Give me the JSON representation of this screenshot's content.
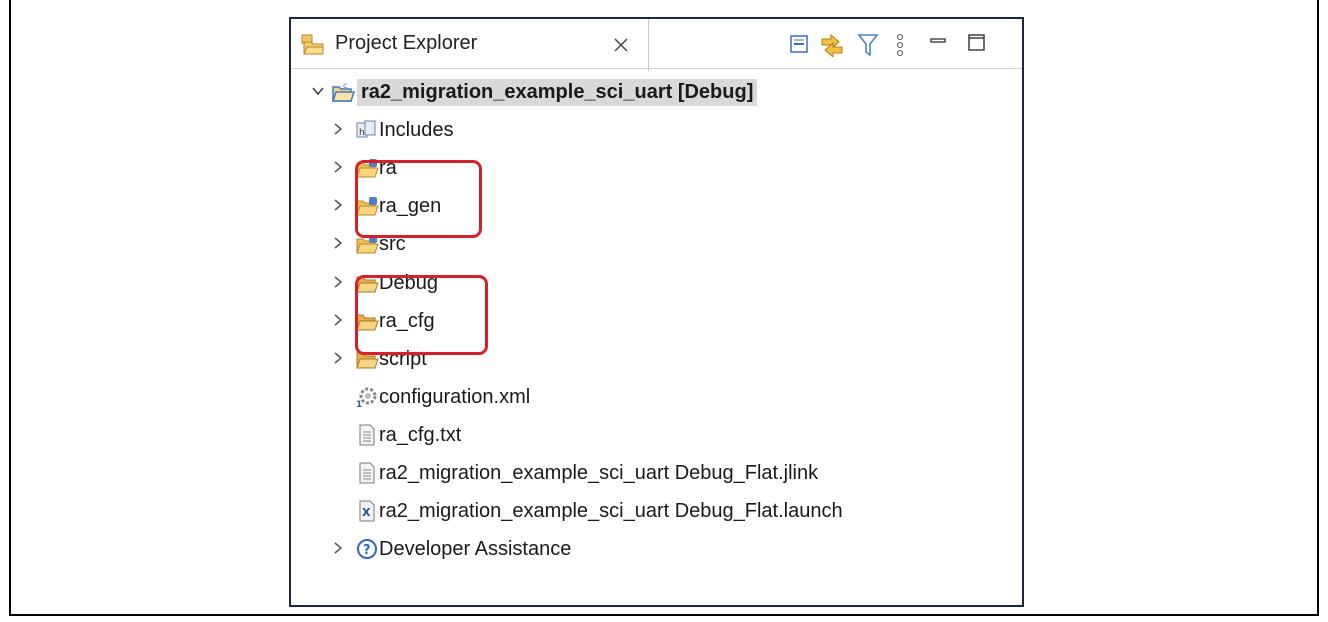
{
  "panel": {
    "tab_label": "Project Explorer"
  },
  "tree": {
    "root": "ra2_migration_example_sci_uart [Debug]",
    "items": [
      {
        "label": "Includes",
        "icon": "includes-icon",
        "expandable": true
      },
      {
        "label": "ra",
        "icon": "source-folder-icon",
        "expandable": true,
        "highlighted": true
      },
      {
        "label": "ra_gen",
        "icon": "source-folder-icon",
        "expandable": true,
        "highlighted": true
      },
      {
        "label": "src",
        "icon": "source-folder-icon",
        "expandable": true
      },
      {
        "label": "Debug",
        "icon": "folder-icon",
        "expandable": true,
        "highlighted": true
      },
      {
        "label": "ra_cfg",
        "icon": "folder-icon",
        "expandable": true,
        "highlighted": true
      },
      {
        "label": "script",
        "icon": "folder-icon",
        "expandable": true
      },
      {
        "label": "configuration.xml",
        "icon": "config-gear-icon",
        "expandable": false
      },
      {
        "label": "ra_cfg.txt",
        "icon": "text-file-icon",
        "expandable": false
      },
      {
        "label": "ra2_migration_example_sci_uart Debug_Flat.jlink",
        "icon": "text-file-icon",
        "expandable": false
      },
      {
        "label": "ra2_migration_example_sci_uart Debug_Flat.launch",
        "icon": "launch-file-icon",
        "expandable": false
      },
      {
        "label": "Developer Assistance",
        "icon": "help-icon",
        "expandable": true
      }
    ]
  },
  "colors": {
    "highlight": "#d6202a",
    "folder": "#e8b04a",
    "selection": "#d9d9d9"
  }
}
